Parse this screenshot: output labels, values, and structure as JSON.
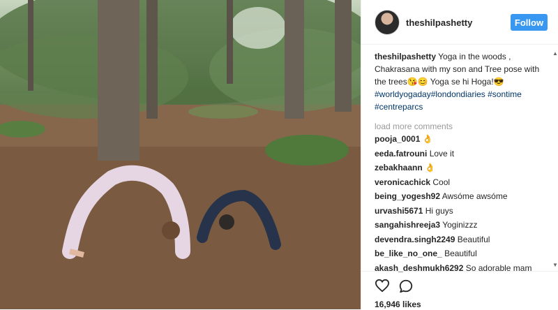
{
  "post": {
    "image_alt": "",
    "username": "theshilpashetty",
    "follow_label": "Follow",
    "caption_user": "theshilpashetty",
    "caption_text": " Yoga in the woods , Chakrasana with my son and Tree pose with the trees😘😊 Yoga se hi Hoga!😎",
    "hashtags": [
      "#worldyogaday",
      "#londondiaries",
      " #sontime",
      " #centreparcs"
    ],
    "load_more": "load more comments",
    "comments": [
      {
        "user": "pooja_0001",
        "text": "👌"
      },
      {
        "user": "eeda.fatrouni",
        "text": "Love it"
      },
      {
        "user": "zebakhaann",
        "text": "👌"
      },
      {
        "user": "veronicachick",
        "text": "Cool"
      },
      {
        "user": "being_yogesh92",
        "text": "Awsóme awsóme"
      },
      {
        "user": "urvashi5671",
        "text": "Hi guys"
      },
      {
        "user": "sangahishreeja3",
        "text": "Yoginizzz"
      },
      {
        "user": "devendra.singh2249",
        "text": "Beautiful"
      },
      {
        "user": "be_like_no_one_",
        "text": "Beautiful"
      },
      {
        "user": "akash_deshmukh6292",
        "text": "So adorable mam"
      }
    ],
    "likes": "16,946 likes",
    "icons": {
      "like": "heart-icon",
      "comment": "comment-icon"
    },
    "colors": {
      "follow": "#3897f0",
      "hashtag": "#003569",
      "muted": "#999999"
    }
  }
}
